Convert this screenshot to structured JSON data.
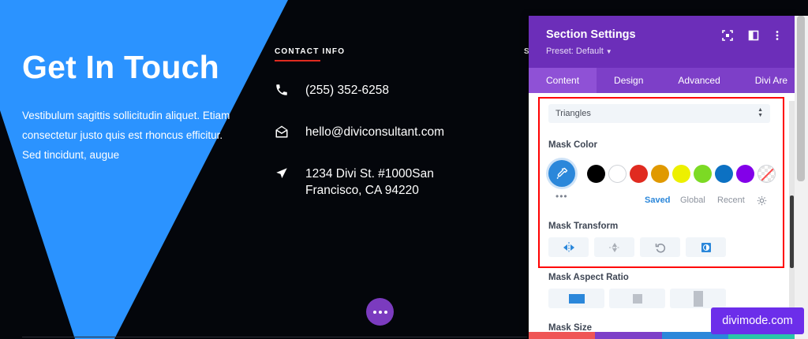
{
  "hero": {
    "title": "Get In Touch",
    "text": "Vestibulum sagittis sollicitudin aliquet. Etiam consectetur justo quis est rhoncus efficitur. Sed tincidunt, augue"
  },
  "contact": {
    "heading": "CONTACT INFO",
    "phone": "(255) 352-6258",
    "email": "hello@diviconsultant.com",
    "address_line1": "1234 Divi St. #1000San",
    "address_line2": "Francisco, CA 94220",
    "cut_heading_letter": "S"
  },
  "panel": {
    "title": "Section Settings",
    "preset": "Preset: Default",
    "tabs": [
      "Content",
      "Design",
      "Advanced",
      "Divi Are"
    ],
    "active_tab": "Content",
    "mask_style_value": "Triangles",
    "mask_color_label": "Mask Color",
    "swatches": [
      "#000000",
      "#ffffff",
      "#e02b20",
      "#e09900",
      "#edf000",
      "#7cda24",
      "#0c71c3",
      "#8300e9"
    ],
    "color_tabs": [
      "Saved",
      "Global",
      "Recent"
    ],
    "active_color_tab": "Saved",
    "mask_transform_label": "Mask Transform",
    "mask_aspect_label": "Mask Aspect Ratio",
    "mask_size_label": "Mask Size"
  },
  "colors": {
    "brand_purple": "#6c2eb9",
    "accent_blue": "#2b87da",
    "hero_blue": "#2b93ff",
    "highlight_red": "#ff0000"
  },
  "watermark": "divimode.com"
}
